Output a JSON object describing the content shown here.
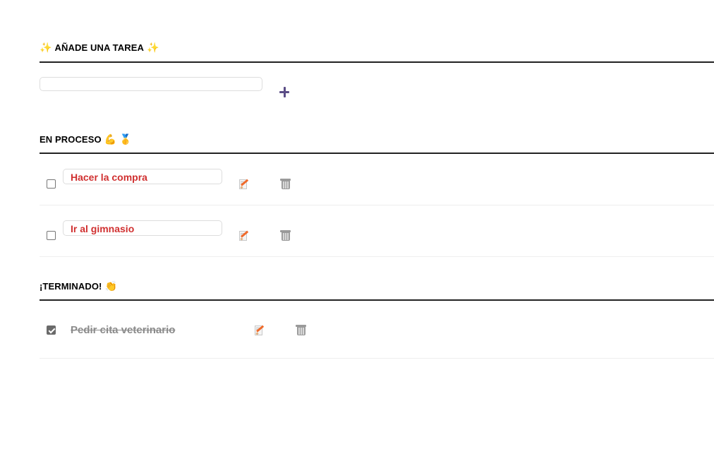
{
  "add_section": {
    "title": "AÑADE UNA TAREA",
    "emoji_left": "✨",
    "emoji_right": "✨",
    "input_value": "",
    "add_button_symbol": "+"
  },
  "in_process": {
    "title": "EN PROCESO",
    "emoji_1": "💪",
    "emoji_2": "🥇",
    "tasks": [
      {
        "text": "Hacer la compra",
        "done": false
      },
      {
        "text": "Ir al gimnasio",
        "done": false
      }
    ]
  },
  "done_section": {
    "title": "¡TERMINADO!",
    "emoji": "👏",
    "tasks": [
      {
        "text": "Pedir cita veterinario",
        "done": true
      }
    ]
  },
  "icons": {
    "edit": "edit-memo-icon",
    "delete": "trash-icon",
    "add": "plus-icon"
  },
  "colors": {
    "pending_text": "#d03030",
    "done_text": "#8a8a8a",
    "add_button": "#5b4d86",
    "rule": "#222222"
  }
}
